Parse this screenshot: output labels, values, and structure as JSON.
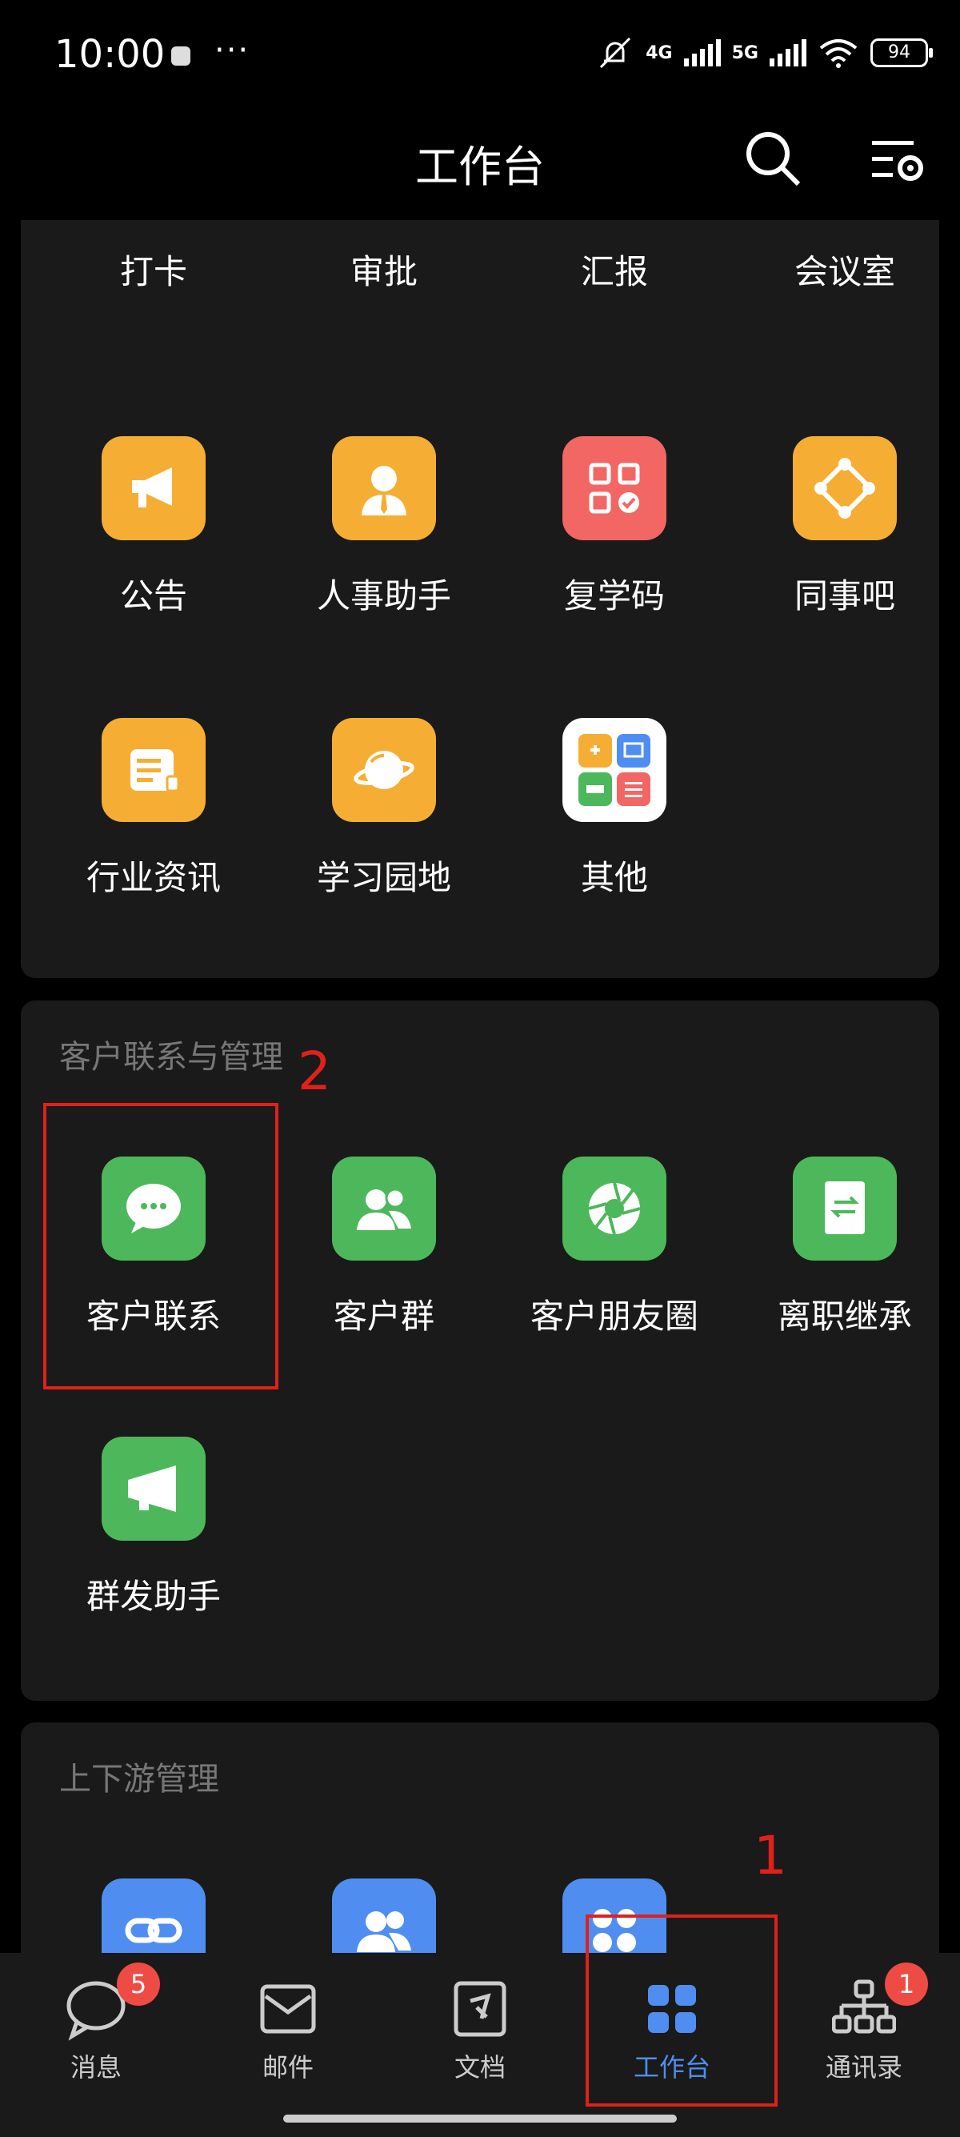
{
  "status_bar": {
    "time": "10:00",
    "more": "···",
    "net1": "4G",
    "net2": "5G",
    "battery": "94"
  },
  "header": {
    "title": "工作台"
  },
  "grid_top": [
    {
      "label": "打卡",
      "icon": "checkin-icon",
      "color": "#F5AE33"
    },
    {
      "label": "审批",
      "icon": "approval-icon",
      "color": "#F5AE33"
    },
    {
      "label": "汇报",
      "icon": "report-icon",
      "color": "#F5AE33"
    },
    {
      "label": "会议室",
      "icon": "meeting-room-icon",
      "color": "#F5AE33"
    },
    {
      "label": "公告",
      "icon": "megaphone-icon",
      "color": "#F5AE33"
    },
    {
      "label": "人事助手",
      "icon": "hr-person-icon",
      "color": "#F5AE33"
    },
    {
      "label": "复学码",
      "icon": "qr-code-icon",
      "color": "#F26664"
    },
    {
      "label": "同事吧",
      "icon": "colleague-network-icon",
      "color": "#F5AE33"
    },
    {
      "label": "行业资讯",
      "icon": "news-icon",
      "color": "#F5AE33"
    },
    {
      "label": "学习园地",
      "icon": "planet-icon",
      "color": "#F5AE33"
    },
    {
      "label": "其他",
      "icon": "other-apps-icon",
      "color": "#FFFFFF"
    }
  ],
  "section_customer": {
    "title": "客户联系与管理",
    "items": [
      {
        "label": "客户联系",
        "icon": "chat-bubble-icon",
        "color": "#4DB85B"
      },
      {
        "label": "客户群",
        "icon": "customer-group-icon",
        "color": "#4DB85B"
      },
      {
        "label": "客户朋友圈",
        "icon": "moments-shutter-icon",
        "color": "#4DB85B"
      },
      {
        "label": "离职继承",
        "icon": "transfer-doc-icon",
        "color": "#4DB85B"
      },
      {
        "label": "群发助手",
        "icon": "broadcast-icon",
        "color": "#4DB85B"
      }
    ]
  },
  "section_updown": {
    "title": "上下游管理"
  },
  "annotations": {
    "one": "1",
    "two": "2"
  },
  "tabs": [
    {
      "label": "消息",
      "badge": "5"
    },
    {
      "label": "邮件",
      "badge": ""
    },
    {
      "label": "文档",
      "badge": ""
    },
    {
      "label": "工作台",
      "badge": ""
    },
    {
      "label": "通讯录",
      "badge": "1"
    }
  ],
  "colors": {
    "accent": "#4F8EF0",
    "annotation": "#E0201A",
    "badge": "#EF4B45"
  }
}
